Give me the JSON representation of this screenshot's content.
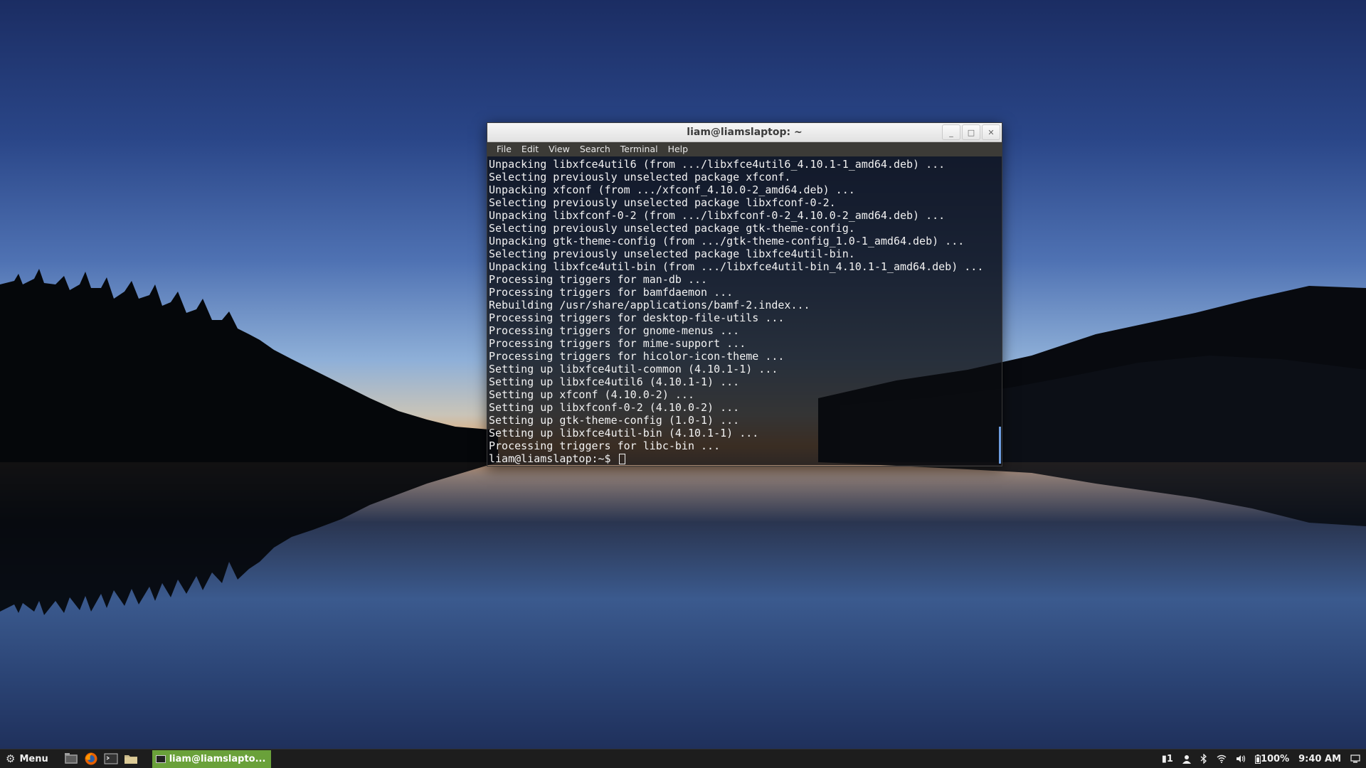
{
  "window": {
    "title": "liam@liamslaptop: ~",
    "minimize_glyph": "_",
    "maximize_glyph": "□",
    "close_glyph": "✕"
  },
  "menubar": {
    "items": [
      "File",
      "Edit",
      "View",
      "Search",
      "Terminal",
      "Help"
    ]
  },
  "terminal": {
    "lines": [
      "Unpacking libxfce4util6 (from .../libxfce4util6_4.10.1-1_amd64.deb) ...",
      "Selecting previously unselected package xfconf.",
      "Unpacking xfconf (from .../xfconf_4.10.0-2_amd64.deb) ...",
      "Selecting previously unselected package libxfconf-0-2.",
      "Unpacking libxfconf-0-2 (from .../libxfconf-0-2_4.10.0-2_amd64.deb) ...",
      "Selecting previously unselected package gtk-theme-config.",
      "Unpacking gtk-theme-config (from .../gtk-theme-config_1.0-1_amd64.deb) ...",
      "Selecting previously unselected package libxfce4util-bin.",
      "Unpacking libxfce4util-bin (from .../libxfce4util-bin_4.10.1-1_amd64.deb) ...",
      "Processing triggers for man-db ...",
      "Processing triggers for bamfdaemon ...",
      "Rebuilding /usr/share/applications/bamf-2.index...",
      "Processing triggers for desktop-file-utils ...",
      "Processing triggers for gnome-menus ...",
      "Processing triggers for mime-support ...",
      "Processing triggers for hicolor-icon-theme ...",
      "Setting up libxfce4util-common (4.10.1-1) ...",
      "Setting up libxfce4util6 (4.10.1-1) ...",
      "Setting up xfconf (4.10.0-2) ...",
      "Setting up libxfconf-0-2 (4.10.0-2) ...",
      "Setting up gtk-theme-config (1.0-1) ...",
      "Setting up libxfce4util-bin (4.10.1-1) ...",
      "Processing triggers for libc-bin ..."
    ],
    "prompt": "liam@liamslaptop:~$ "
  },
  "taskbar": {
    "menu_label": "Menu",
    "launchers": [
      "file-manager-icon",
      "firefox-icon",
      "terminal-icon",
      "folder-icon"
    ],
    "task_label": "liam@liamslapto...",
    "tray": {
      "notifications": "1",
      "battery": "100%",
      "clock": "9:40 AM"
    }
  },
  "colors": {
    "task_active": "#6aa13a",
    "taskbar_bg": "#1d1d1d",
    "terminal_bg": "#0a0c10",
    "scrollbar": "#6e9ee0"
  }
}
